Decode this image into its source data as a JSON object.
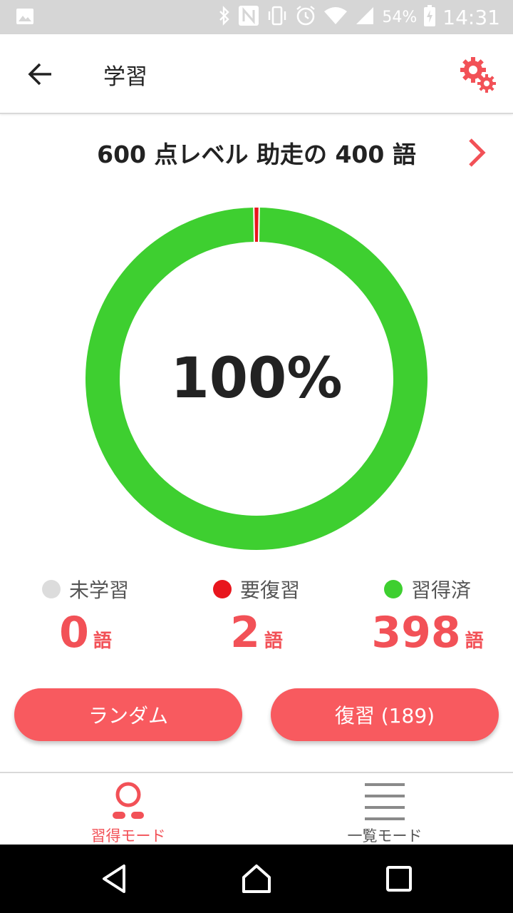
{
  "status_bar": {
    "battery": "54%",
    "time": "14:31",
    "icons": [
      "image-icon",
      "bluetooth-icon",
      "nfc-icon",
      "vibrate-icon",
      "alarm-icon",
      "wifi-icon",
      "signal-icon",
      "battery-charging-icon"
    ]
  },
  "app_bar": {
    "title": "学習",
    "back_icon": "arrow-left-icon",
    "settings_icon": "gears-icon"
  },
  "course": {
    "title": "600 点レベル 助走の 400 語",
    "next_icon": "chevron-right-icon"
  },
  "progress": {
    "percent_label": "100%",
    "total": 400,
    "unlearned": 0,
    "review": 2,
    "mastered": 398
  },
  "stats": [
    {
      "label": "未学習",
      "value": "0",
      "unit": "語",
      "color": "#dcdcdc"
    },
    {
      "label": "要復習",
      "value": "2",
      "unit": "語",
      "color": "#e8161d"
    },
    {
      "label": "習得済",
      "value": "398",
      "unit": "語",
      "color": "#3ecf30"
    }
  ],
  "actions": {
    "random_label": "ランダム",
    "review_label": "復習 (189)"
  },
  "bottom_nav": {
    "items": [
      {
        "label": "習得モード",
        "icon": "person-icon",
        "active": true
      },
      {
        "label": "一覧モード",
        "icon": "list-icon",
        "active": false
      }
    ]
  },
  "colors": {
    "accent": "#f85a5f",
    "accent_text": "#f25157",
    "mastered": "#3ecf30",
    "review": "#e8161d",
    "unlearned": "#dcdcdc",
    "inactive": "#8a8a8a"
  }
}
